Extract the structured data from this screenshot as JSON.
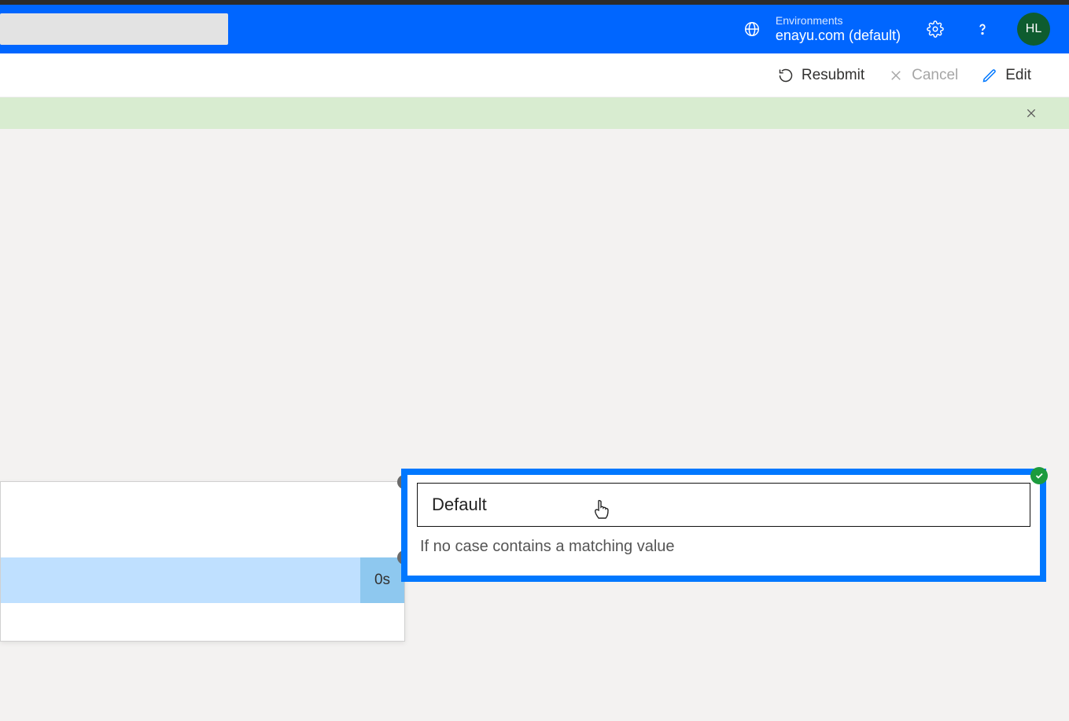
{
  "header": {
    "search_placeholder": "",
    "environments_label": "Environments",
    "environment_name": "enayu.com (default)",
    "avatar_initials": "HL"
  },
  "command_bar": {
    "resubmit_label": "Resubmit",
    "cancel_label": "Cancel",
    "edit_label": "Edit"
  },
  "left_card": {
    "duration": "0s"
  },
  "default_card": {
    "title": "Default",
    "description": "If no case contains a matching value"
  }
}
